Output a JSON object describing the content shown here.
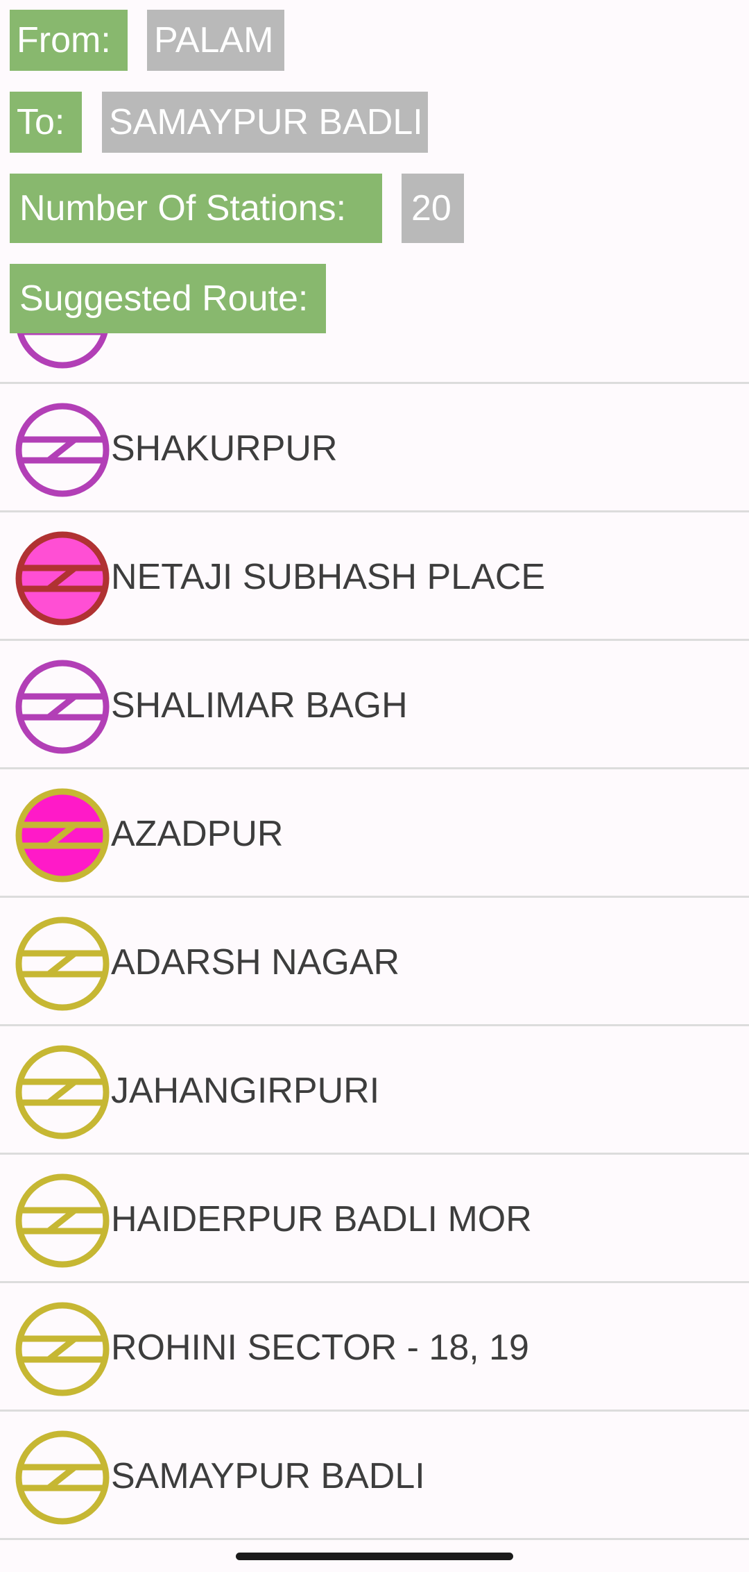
{
  "header": {
    "from_label": "From:",
    "from_value": "PALAM",
    "to_label": "To:",
    "to_value": "SAMAYPUR BADLI",
    "stations_label": "Number Of Stations:",
    "stations_value": "20",
    "route_label": "Suggested Route:"
  },
  "colors": {
    "label_bg": "#88b86e",
    "value_bg": "#b9b9b9",
    "magenta_line": "#b23fb6",
    "yellow_line": "#c6b733",
    "red_line": "#b03232",
    "pink_fill": "#ff4fd4",
    "hot_pink_fill": "#ff1ac8"
  },
  "stations": [
    {
      "name": "",
      "icon": "metro-logo-magenta-line-icon",
      "ring": "#b23fb6",
      "fill": "none"
    },
    {
      "name": "SHAKURPUR",
      "icon": "metro-logo-magenta-line-icon",
      "ring": "#b23fb6",
      "fill": "none"
    },
    {
      "name": "NETAJI SUBHASH PLACE",
      "icon": "metro-logo-interchange-icon",
      "ring": "#b03232",
      "fill": "#ff4fd4"
    },
    {
      "name": "SHALIMAR BAGH",
      "icon": "metro-logo-magenta-line-icon",
      "ring": "#b23fb6",
      "fill": "none"
    },
    {
      "name": "AZADPUR",
      "icon": "metro-logo-interchange-icon",
      "ring": "#c6b733",
      "fill": "#ff1ac8"
    },
    {
      "name": "ADARSH NAGAR",
      "icon": "metro-logo-yellow-line-icon",
      "ring": "#c6b733",
      "fill": "none"
    },
    {
      "name": "JAHANGIRPURI",
      "icon": "metro-logo-yellow-line-icon",
      "ring": "#c6b733",
      "fill": "none"
    },
    {
      "name": "HAIDERPUR BADLI MOR",
      "icon": "metro-logo-yellow-line-icon",
      "ring": "#c6b733",
      "fill": "none"
    },
    {
      "name": "ROHINI SECTOR - 18, 19",
      "icon": "metro-logo-yellow-line-icon",
      "ring": "#c6b733",
      "fill": "none"
    },
    {
      "name": "SAMAYPUR BADLI",
      "icon": "metro-logo-yellow-line-icon",
      "ring": "#c6b733",
      "fill": "none"
    }
  ]
}
